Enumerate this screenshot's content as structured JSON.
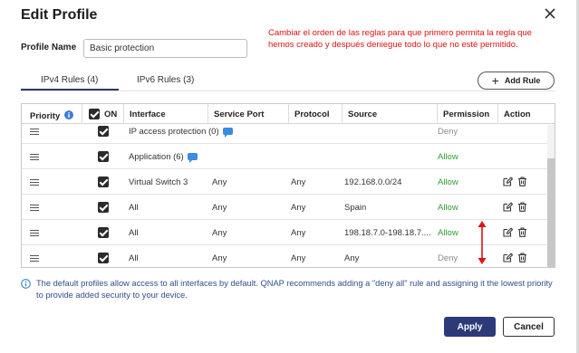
{
  "dialog": {
    "title": "Edit Profile",
    "close_icon": "close-icon"
  },
  "annotation": "Cambiar el orden de las reglas para que primero permita la regla que hemos creado y después deniegue todo lo que no esté permitido.",
  "profile": {
    "label": "Profile Name",
    "value": "Basic protection"
  },
  "tabs": [
    {
      "label": "IPv4 Rules (4)",
      "active": true
    },
    {
      "label": "IPv6 Rules (3)",
      "active": false
    }
  ],
  "add_rule": {
    "label": "Add Rule",
    "icon": "plus-icon"
  },
  "table": {
    "headers": {
      "priority": "Priority",
      "on": "ON",
      "interface": "Interface",
      "service_port": "Service Port",
      "protocol": "Protocol",
      "source": "Source",
      "permission": "Permission",
      "action": "Action"
    },
    "rows": [
      {
        "interface": "IP access protection (0)",
        "service_port": "",
        "protocol": "",
        "source": "",
        "permission": "Deny",
        "has_actions": false,
        "has_chat": true
      },
      {
        "interface": "Application (6)",
        "service_port": "",
        "protocol": "",
        "source": "",
        "permission": "Allow",
        "has_actions": false,
        "has_chat": true
      },
      {
        "interface": "Virtual Switch 3",
        "service_port": "Any",
        "protocol": "Any",
        "source": "192.168.0.0/24",
        "permission": "Allow",
        "has_actions": true,
        "has_chat": false
      },
      {
        "interface": "All",
        "service_port": "Any",
        "protocol": "Any",
        "source": "Spain",
        "permission": "Allow",
        "has_actions": true,
        "has_chat": false
      },
      {
        "interface": "All",
        "service_port": "Any",
        "protocol": "Any",
        "source": "198.18.7.0-198.18.7....",
        "permission": "Allow",
        "has_actions": true,
        "has_chat": false
      },
      {
        "interface": "All",
        "service_port": "Any",
        "protocol": "Any",
        "source": "Any",
        "permission": "Deny",
        "has_actions": true,
        "has_chat": false
      }
    ]
  },
  "info": "The default profiles allow access to all interfaces by default. QNAP recommends adding a \"deny all\" rule and assigning it the lowest priority to provide added security to your device.",
  "buttons": {
    "apply": "Apply",
    "cancel": "Cancel"
  },
  "colors": {
    "allow": "#2da02d",
    "deny": "#8a8a8a",
    "annotation": "#e01010",
    "primary": "#2d3a7a",
    "info": "#2f4f8f",
    "arrow": "#e01010"
  }
}
